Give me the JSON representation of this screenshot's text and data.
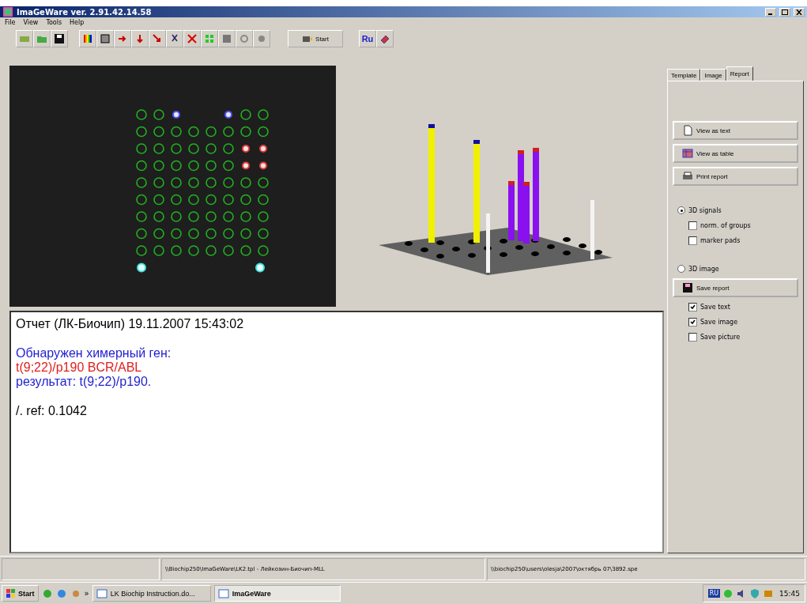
{
  "window": {
    "title": "ImaGeWare ver. 2.91.42.14.58"
  },
  "menu": [
    "File",
    "View",
    "Tools",
    "Help"
  ],
  "toolbar": {
    "start_label": "Start",
    "language_label": "Ru"
  },
  "report": {
    "paragraphs": [
      {
        "lines": [
          {
            "text": "Отчет  (ЛК-Биочип) 19.11.2007 15:43:02",
            "color": "#000000"
          }
        ]
      },
      {
        "lines": [
          {
            "text": "Обнаружен химерный ген:",
            "color": "#1f1fd0"
          },
          {
            "text": "t(9;22)/p190 BCR/ABL",
            "color": "#e02020"
          },
          {
            "text": "результат: t(9;22)/p190.",
            "color": "#1f1fd0"
          }
        ]
      },
      {
        "lines": [
          {
            "text": "/.  ref: 0.1042",
            "color": "#000000"
          }
        ]
      }
    ]
  },
  "side_panel": {
    "tabs": [
      {
        "label": "Template",
        "selected": false
      },
      {
        "label": "Image",
        "selected": false
      },
      {
        "label": "Report",
        "selected": true
      }
    ],
    "view_buttons": [
      {
        "label": "View as text",
        "kind": "text"
      },
      {
        "label": "View as table",
        "kind": "table"
      },
      {
        "label": "Print report",
        "kind": "print"
      }
    ],
    "mode_options": [
      {
        "label": "3D signals",
        "selected": true,
        "options": [
          {
            "label": "norm. of groups",
            "checked": false
          },
          {
            "label": "marker pads",
            "checked": false
          }
        ]
      },
      {
        "label": "3D image",
        "selected": false
      }
    ],
    "save_button": {
      "label": "Save report"
    },
    "save_options": [
      {
        "label": "Save text",
        "checked": true
      },
      {
        "label": "Save image",
        "checked": true
      },
      {
        "label": "Save picture",
        "checked": false
      }
    ]
  },
  "status_bar": [
    "\\\\Biochip250\\ImaGeWare\\LK2.tpl - Лейкозин-Биочип-MLL",
    "\\\\biochip250\\users\\olesja\\2007\\октябрь 07\\3892.spe"
  ],
  "taskbar": {
    "start": "Start",
    "more": "»",
    "tasks": [
      {
        "label": "LK Biochip Instruction.do...",
        "selected": false
      },
      {
        "label": "ImaGeWare",
        "selected": true
      }
    ],
    "language": "RU",
    "clock": "15:45"
  }
}
